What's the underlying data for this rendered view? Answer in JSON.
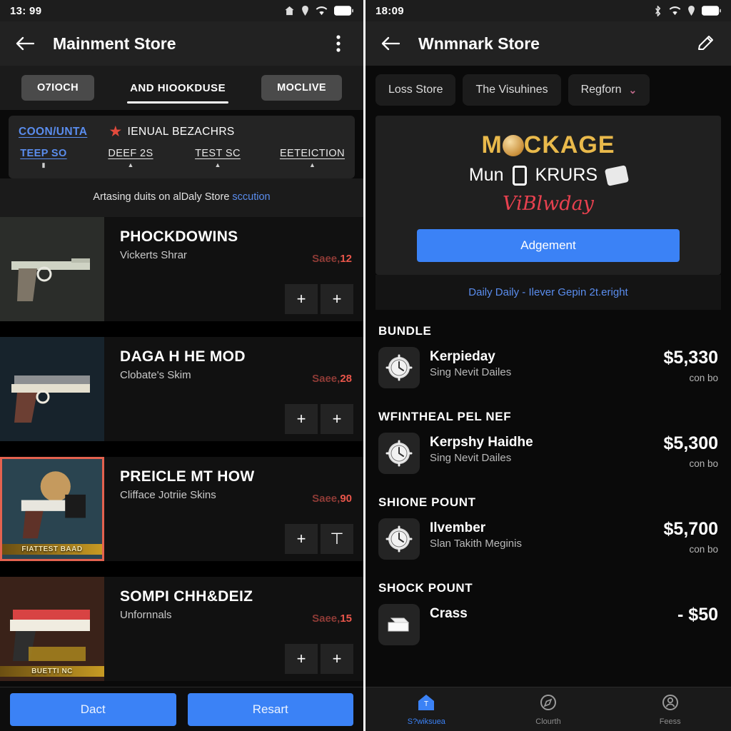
{
  "left": {
    "status": {
      "time": "13: 99",
      "icons": [
        "home-icon",
        "location-icon",
        "wifi-icon",
        "battery-icon"
      ]
    },
    "appbar": {
      "back": "back-arrow-icon",
      "title": "Mainment Store",
      "menu": "overflow-menu-icon"
    },
    "tabs": [
      {
        "label": "O7IOCH",
        "style": "chip"
      },
      {
        "label": "AND HIOOKDUSE",
        "style": "active"
      },
      {
        "label": "MOCLIVE",
        "style": "chip"
      }
    ],
    "filters": {
      "row1": [
        {
          "label": "COON/UNTA",
          "type": "link"
        },
        {
          "label": "IENUAL BEZACHRS",
          "type": "star"
        }
      ],
      "row2": [
        {
          "label": "TEEP SO",
          "caret": "▮",
          "selected": true
        },
        {
          "label": "DEEF 2S",
          "caret": "▲",
          "selected": false
        },
        {
          "label": "TEST SC",
          "caret": "▲",
          "selected": false
        },
        {
          "label": "EETEICTION",
          "caret": "▲",
          "selected": false
        }
      ]
    },
    "note": {
      "text": "Artasing duits on alDaly Store ",
      "link": "sccution"
    },
    "items": [
      {
        "title": "PHOCKDOWINS",
        "sub": "Vickerts Shrar",
        "price_a": "Saee,",
        "price_b": "12",
        "badge": "",
        "framed": false,
        "plus1": "+",
        "plus2": "+"
      },
      {
        "title": "DAGA H HE MOD",
        "sub": "Clobate's Skim",
        "price_a": "Saee,",
        "price_b": "28",
        "badge": "",
        "framed": false,
        "plus1": "+",
        "plus2": "+"
      },
      {
        "title": "PREICLE MT HOW",
        "sub": "Clifface Jotriie Skins",
        "price_a": "Saee,",
        "price_b": "90",
        "badge": "FIATTEST BAAD",
        "framed": true,
        "plus1": "+",
        "plus2": "⊤"
      },
      {
        "title": "SOMPI CHH&DEIZ",
        "sub": "Unfornnals",
        "price_a": "Saee,",
        "price_b": "15",
        "badge": "BUETTI NC",
        "framed": false,
        "plus1": "+",
        "plus2": "+"
      }
    ],
    "actions": [
      "Dact",
      "Resart"
    ]
  },
  "right": {
    "status": {
      "time": "18:09",
      "icons": [
        "bluetooth-icon",
        "wifi-icon",
        "location-icon",
        "battery-icon"
      ]
    },
    "appbar": {
      "back": "back-arrow-icon",
      "title": "Wnmnark Store",
      "edit": "pencil-icon"
    },
    "chips": [
      {
        "label": "Loss Store",
        "chevron": ""
      },
      {
        "label": "The Visuhines",
        "chevron": ""
      },
      {
        "label": "Regforn",
        "chevron": "⌄"
      }
    ],
    "banner": {
      "headline_pre": "M",
      "headline_post": "CKAGE",
      "line2_a": "Mun",
      "line2_b": "KRURS",
      "script": "ViBlwday",
      "cta": "Adgement",
      "footer": "Daily Daily - Ilever Gepin 2t.eright"
    },
    "sections": [
      {
        "header": "BUNDLE",
        "rows": [
          {
            "icon": "clock-icon",
            "name": "Kerpieday",
            "desc": "Sing Nevit Dailes",
            "price": "$5,330",
            "note": "con bo"
          }
        ]
      },
      {
        "header": "WFINTHEAL PEL NEF",
        "rows": [
          {
            "icon": "clock-icon",
            "name": "Kerpshy Haidhe",
            "desc": "Sing Nevit Dailes",
            "price": "$5,300",
            "note": "con bo"
          }
        ]
      },
      {
        "header": "SHIONE POUNT",
        "rows": [
          {
            "icon": "clock-icon",
            "name": "Ilvember",
            "desc": "Slan Takith Meginis",
            "price": "$5,700",
            "note": "con bo"
          }
        ]
      },
      {
        "header": "SHOCK POUNT",
        "rows": [
          {
            "icon": "printer-icon",
            "name": "Crass",
            "desc": "",
            "price": "- $50",
            "note": ""
          }
        ]
      }
    ],
    "nav": [
      {
        "label": "S?wiksuea",
        "icon": "home-icon",
        "active": true
      },
      {
        "label": "Clourth",
        "icon": "compass-icon",
        "active": false
      },
      {
        "label": "Feess",
        "icon": "profile-icon",
        "active": false
      }
    ]
  },
  "colors": {
    "accent": "#3b82f6",
    "link": "#5a8dee",
    "price_red": "#e8554a",
    "gold": "#e9b94b",
    "script_red": "#e8414f"
  }
}
